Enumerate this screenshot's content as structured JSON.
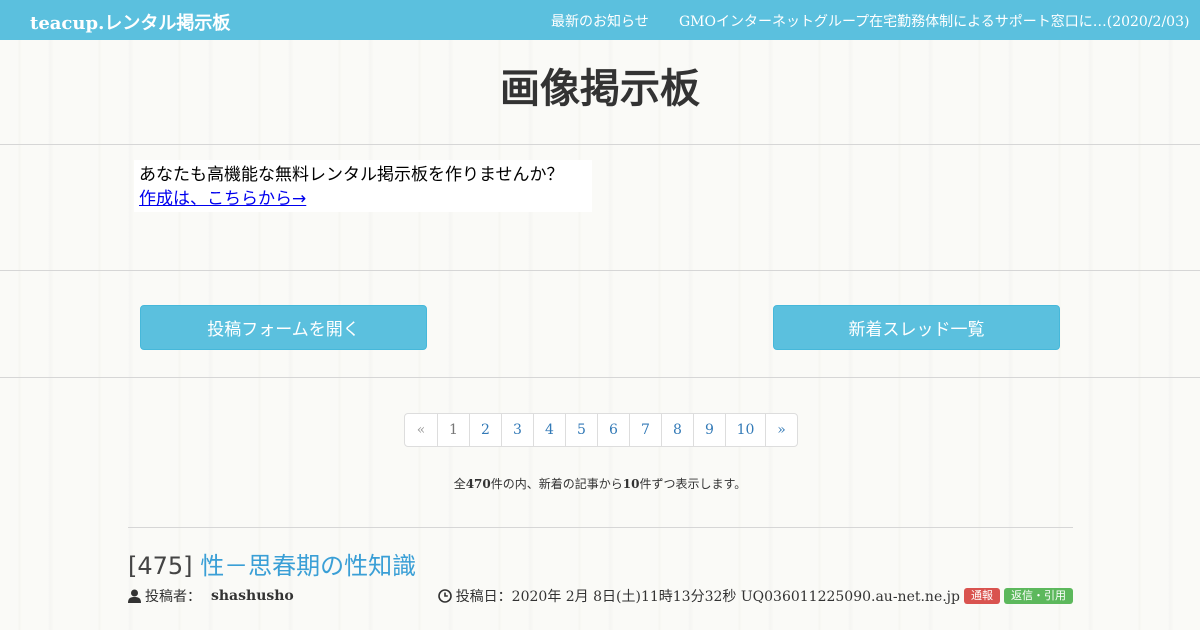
{
  "navbar": {
    "brand": "teacup.レンタル掲示板",
    "news_label": "最新のお知らせ",
    "notice": "GMOインターネットグループ在宅勤務体制によるサポート窓口に…(2020/2/03)",
    "bg_color": "#5bc0de"
  },
  "page": {
    "title": "画像掲示板"
  },
  "ad": {
    "text": "あなたも高機能な無料レンタル掲示板を作りませんか？",
    "link": "作成は、こちらから→"
  },
  "actions": {
    "post_form": "投稿フォームを開く",
    "new_threads": "新着スレッド一覧"
  },
  "pagination": {
    "prev": "«",
    "pages": [
      "1",
      "2",
      "3",
      "4",
      "5",
      "6",
      "7",
      "8",
      "9",
      "10"
    ],
    "current": "1",
    "next": "»"
  },
  "summary": {
    "prefix": "全",
    "total": "470",
    "middle": "件の内、新着の記事から",
    "per_page": "10",
    "suffix": "件ずつ表示します。"
  },
  "post": {
    "number": "[475]",
    "subject": "性－思春期の性知識",
    "poster_label": "投稿者：",
    "poster_name": "shashusho",
    "date_label": "投稿日：2020年 2月 8日(土)11時13分32秒 UQ036011225090.au-net.ne.jp",
    "report_label": "通報",
    "reply_label": "返信・引用",
    "icons": {
      "poster": "user-icon",
      "date": "clock-icon"
    }
  }
}
